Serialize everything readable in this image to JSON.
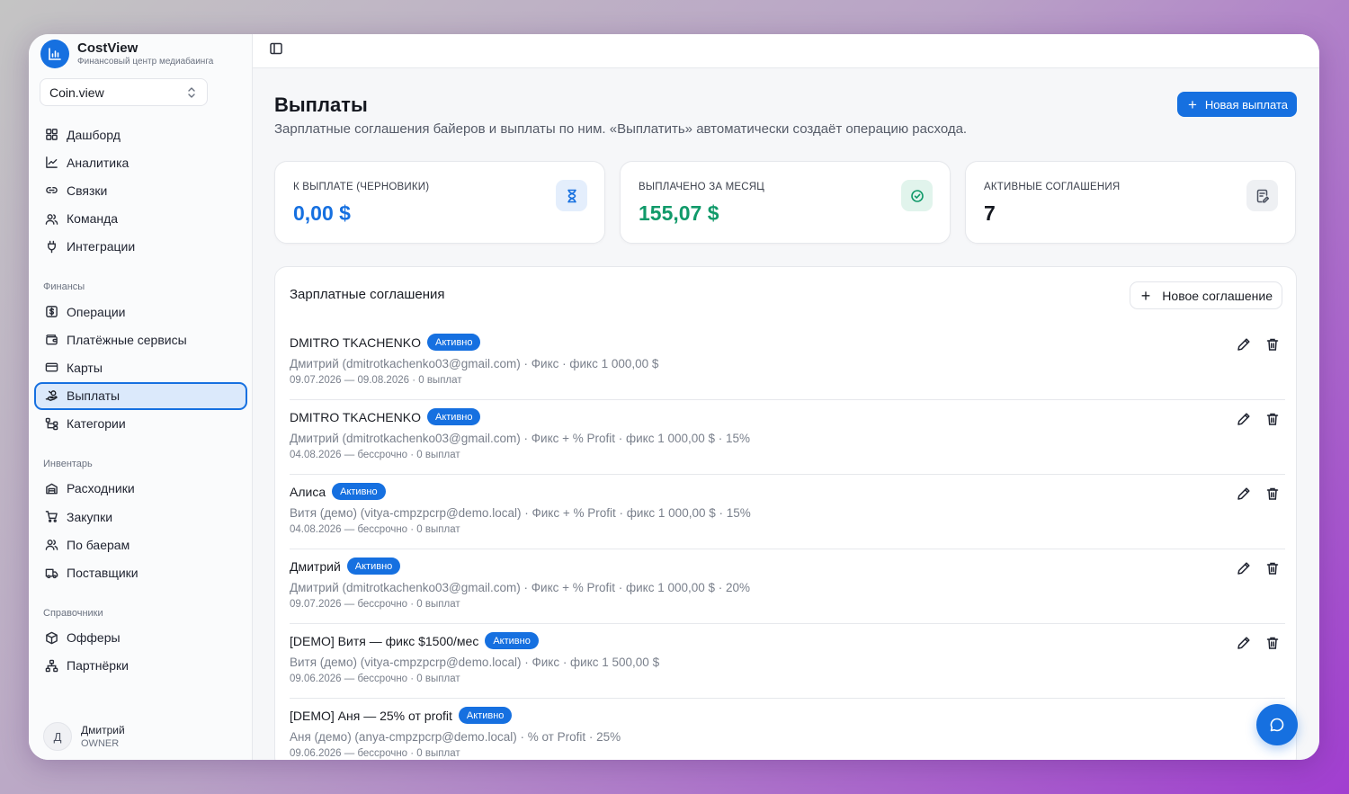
{
  "brand": {
    "name": "CostView",
    "subtitle": "Финансовый центр медиабаинга"
  },
  "workspace": {
    "name": "Coin.view"
  },
  "nav": {
    "main": [
      {
        "label": "Дашборд",
        "icon": "dashboard-icon"
      },
      {
        "label": "Аналитика",
        "icon": "chart-icon"
      },
      {
        "label": "Связки",
        "icon": "link-icon"
      },
      {
        "label": "Команда",
        "icon": "team-icon"
      },
      {
        "label": "Интеграции",
        "icon": "plug-icon"
      }
    ],
    "finance_title": "Финансы",
    "finance": [
      {
        "label": "Операции",
        "icon": "dollar-icon"
      },
      {
        "label": "Платёжные сервисы",
        "icon": "wallet-icon"
      },
      {
        "label": "Карты",
        "icon": "card-icon"
      },
      {
        "label": "Выплаты",
        "icon": "payout-icon",
        "active": true
      },
      {
        "label": "Категории",
        "icon": "tree-icon"
      }
    ],
    "inventory_title": "Инвентарь",
    "inventory": [
      {
        "label": "Расходники",
        "icon": "box-icon"
      },
      {
        "label": "Закупки",
        "icon": "cart-icon"
      },
      {
        "label": "По баерам",
        "icon": "users-icon"
      },
      {
        "label": "Поставщики",
        "icon": "truck-icon"
      }
    ],
    "reference_title": "Справочники",
    "reference": [
      {
        "label": "Офферы",
        "icon": "package-icon"
      },
      {
        "label": "Партнёрки",
        "icon": "network-icon"
      }
    ]
  },
  "user": {
    "name": "Дмитрий",
    "role": "OWNER",
    "initial": "Д"
  },
  "page": {
    "title": "Выплаты",
    "description": "Зарплатные соглашения байеров и выплаты по ним. «Выплатить» автоматически создаёт операцию расхода.",
    "new_payout_label": "Новая выплата"
  },
  "stats": [
    {
      "label": "К ВЫПЛАТЕ (ЧЕРНОВИКИ)",
      "value": "0,00 $",
      "color": "#1670e0",
      "icon": "hourglass-icon"
    },
    {
      "label": "ВЫПЛАЧЕНО ЗА МЕСЯЦ",
      "value": "155,07 $",
      "color": "#119a6a",
      "icon": "check-circle-icon"
    },
    {
      "label": "АКТИВНЫЕ СОГЛАШЕНИЯ",
      "value": "7",
      "color": "#14171f",
      "icon": "edit-doc-icon"
    }
  ],
  "agreements": {
    "title": "Зарплатные соглашения",
    "new_label": "Новое соглашение",
    "rows": [
      {
        "name": "DMITRO TKACHENKO",
        "status": "Активно",
        "details": "Дмитрий (dmitrotkachenko03@gmail.com) · Фикс · фикс 1 000,00 $",
        "meta": "09.07.2026 — 09.08.2026 · 0 выплат"
      },
      {
        "name": "DMITRO TKACHENKO",
        "status": "Активно",
        "details": "Дмитрий (dmitrotkachenko03@gmail.com) · Фикс + % Profit · фикс 1 000,00 $ · 15%",
        "meta": "04.08.2026 — бессрочно · 0 выплат"
      },
      {
        "name": "Алиса",
        "status": "Активно",
        "details": "Витя (демо) (vitya-cmpzpcrp@demo.local) · Фикс + % Profit · фикс 1 000,00 $ · 15%",
        "meta": "04.08.2026 — бессрочно · 0 выплат"
      },
      {
        "name": "Дмитрий",
        "status": "Активно",
        "details": "Дмитрий (dmitrotkachenko03@gmail.com) · Фикс + % Profit · фикс 1 000,00 $ · 20%",
        "meta": "09.07.2026 — бессрочно · 0 выплат"
      },
      {
        "name": "[DEMO] Витя — фикс $1500/мес",
        "status": "Активно",
        "details": "Витя (демо) (vitya-cmpzpcrp@demo.local) · Фикс · фикс 1 500,00 $",
        "meta": "09.06.2026 — бессрочно · 0 выплат"
      },
      {
        "name": "[DEMO] Аня — 25% от profit",
        "status": "Активно",
        "details": "Аня (демо) (anya-cmpzpcrp@demo.local) · % от Profit · 25%",
        "meta": "09.06.2026 — бессрочно · 0 выплат"
      }
    ]
  },
  "colors": {
    "accent": "#1670e0",
    "success": "#119a6a"
  }
}
